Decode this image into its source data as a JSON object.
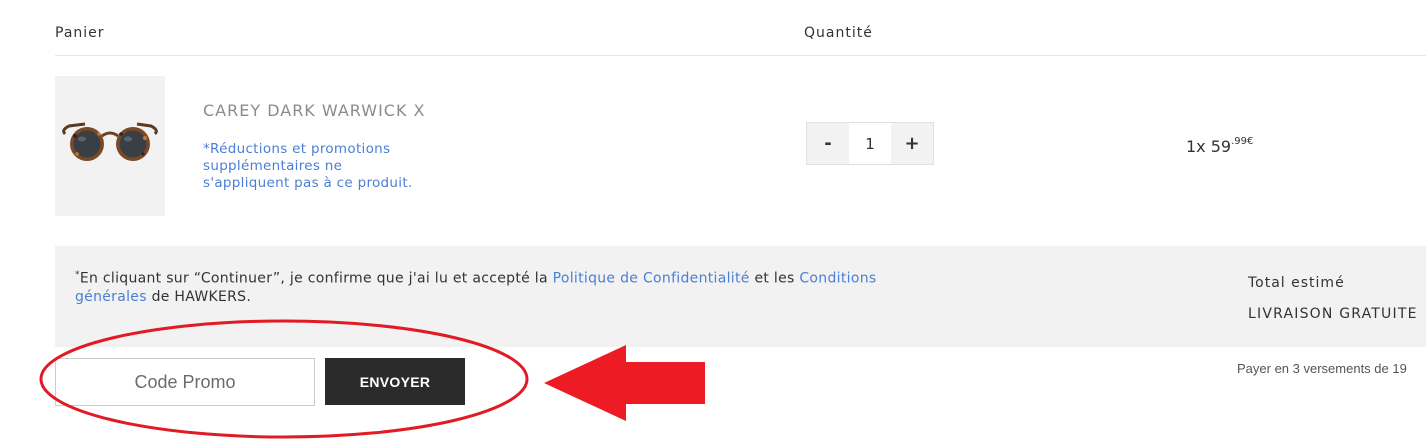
{
  "cart_header": {
    "cart_label": "Panier",
    "quantity_label": "Quantité"
  },
  "product": {
    "name": "CAREY DARK WARWICK X",
    "note": "*Réductions et promotions supplémentaires ne s'appliquent pas à ce produit.",
    "quantity": "1",
    "decrement_label": "-",
    "increment_label": "+",
    "price_prefix": "1x 59",
    "price_cents": ".99€"
  },
  "summary": {
    "legal_asterisk": "*",
    "legal_text_1": "En cliquant sur “Continuer”, je confirme que j'ai lu et accepté la ",
    "privacy_link": "Politique de Confidentialité",
    "legal_text_2": " et les ",
    "terms_link": "Conditions générales",
    "legal_text_3": " de HAWKERS.",
    "total_label": "Total estimé",
    "shipping_label": "LIVRAISON GRATUITE"
  },
  "promo": {
    "placeholder": "Code Promo",
    "submit_label": "ENVOYER"
  },
  "installments_text": "Payer en 3 versements de 19",
  "annotation": {
    "ellipse_color": "#e01b24",
    "arrow_color": "#ed1c24"
  },
  "icons": {
    "product_image": "sunglasses-tortoise-image"
  }
}
